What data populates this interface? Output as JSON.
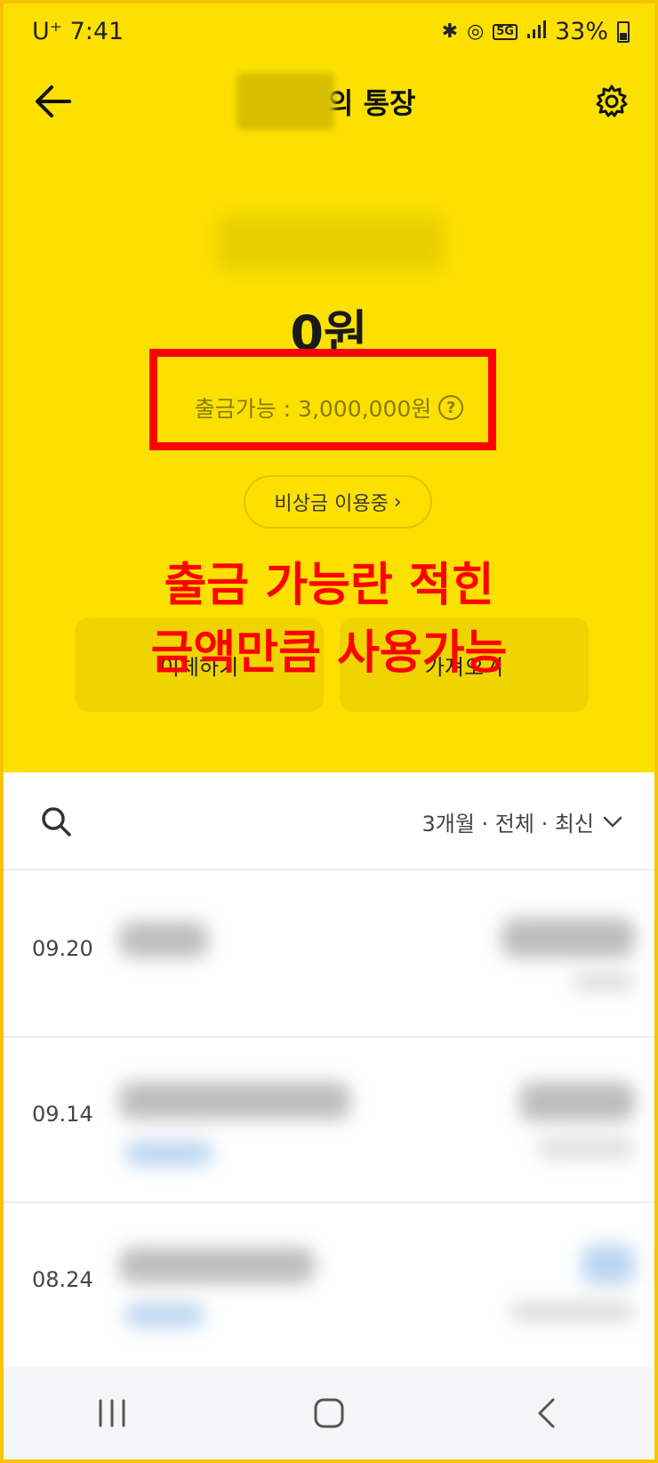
{
  "status_bar": {
    "carrier_time": "U⁺ 7:41",
    "network": "5G",
    "battery": "33%"
  },
  "header": {
    "title_suffix": "의 통장",
    "back_icon": "arrow-left-icon",
    "settings_icon": "gear-icon"
  },
  "account": {
    "balance": "0원",
    "withdrawable": "출금가능 : 3,000,000원",
    "help_symbol": "?",
    "emergency_label": "비상금 이용중",
    "emergency_chevron": "›"
  },
  "actions": {
    "transfer_label": "이체하기",
    "fetch_label": "가져오기"
  },
  "annotation": {
    "line1": "출금 가능란 적힌",
    "line2": "금액만큼 사용가능",
    "color": "#ff0000"
  },
  "filter": {
    "label": "3개월 · 전체 · 최신",
    "search_icon": "search-icon",
    "dropdown_icon": "chevron-down-icon"
  },
  "transactions": [
    {
      "date": "09.20"
    },
    {
      "date": "09.14"
    },
    {
      "date": "08.24"
    }
  ],
  "nav": {
    "recent_icon": "recent-apps-icon",
    "home_icon": "home-icon",
    "back_icon": "back-icon"
  },
  "colors": {
    "brand_yellow": "#fce100",
    "highlight_red": "#ff0000"
  }
}
